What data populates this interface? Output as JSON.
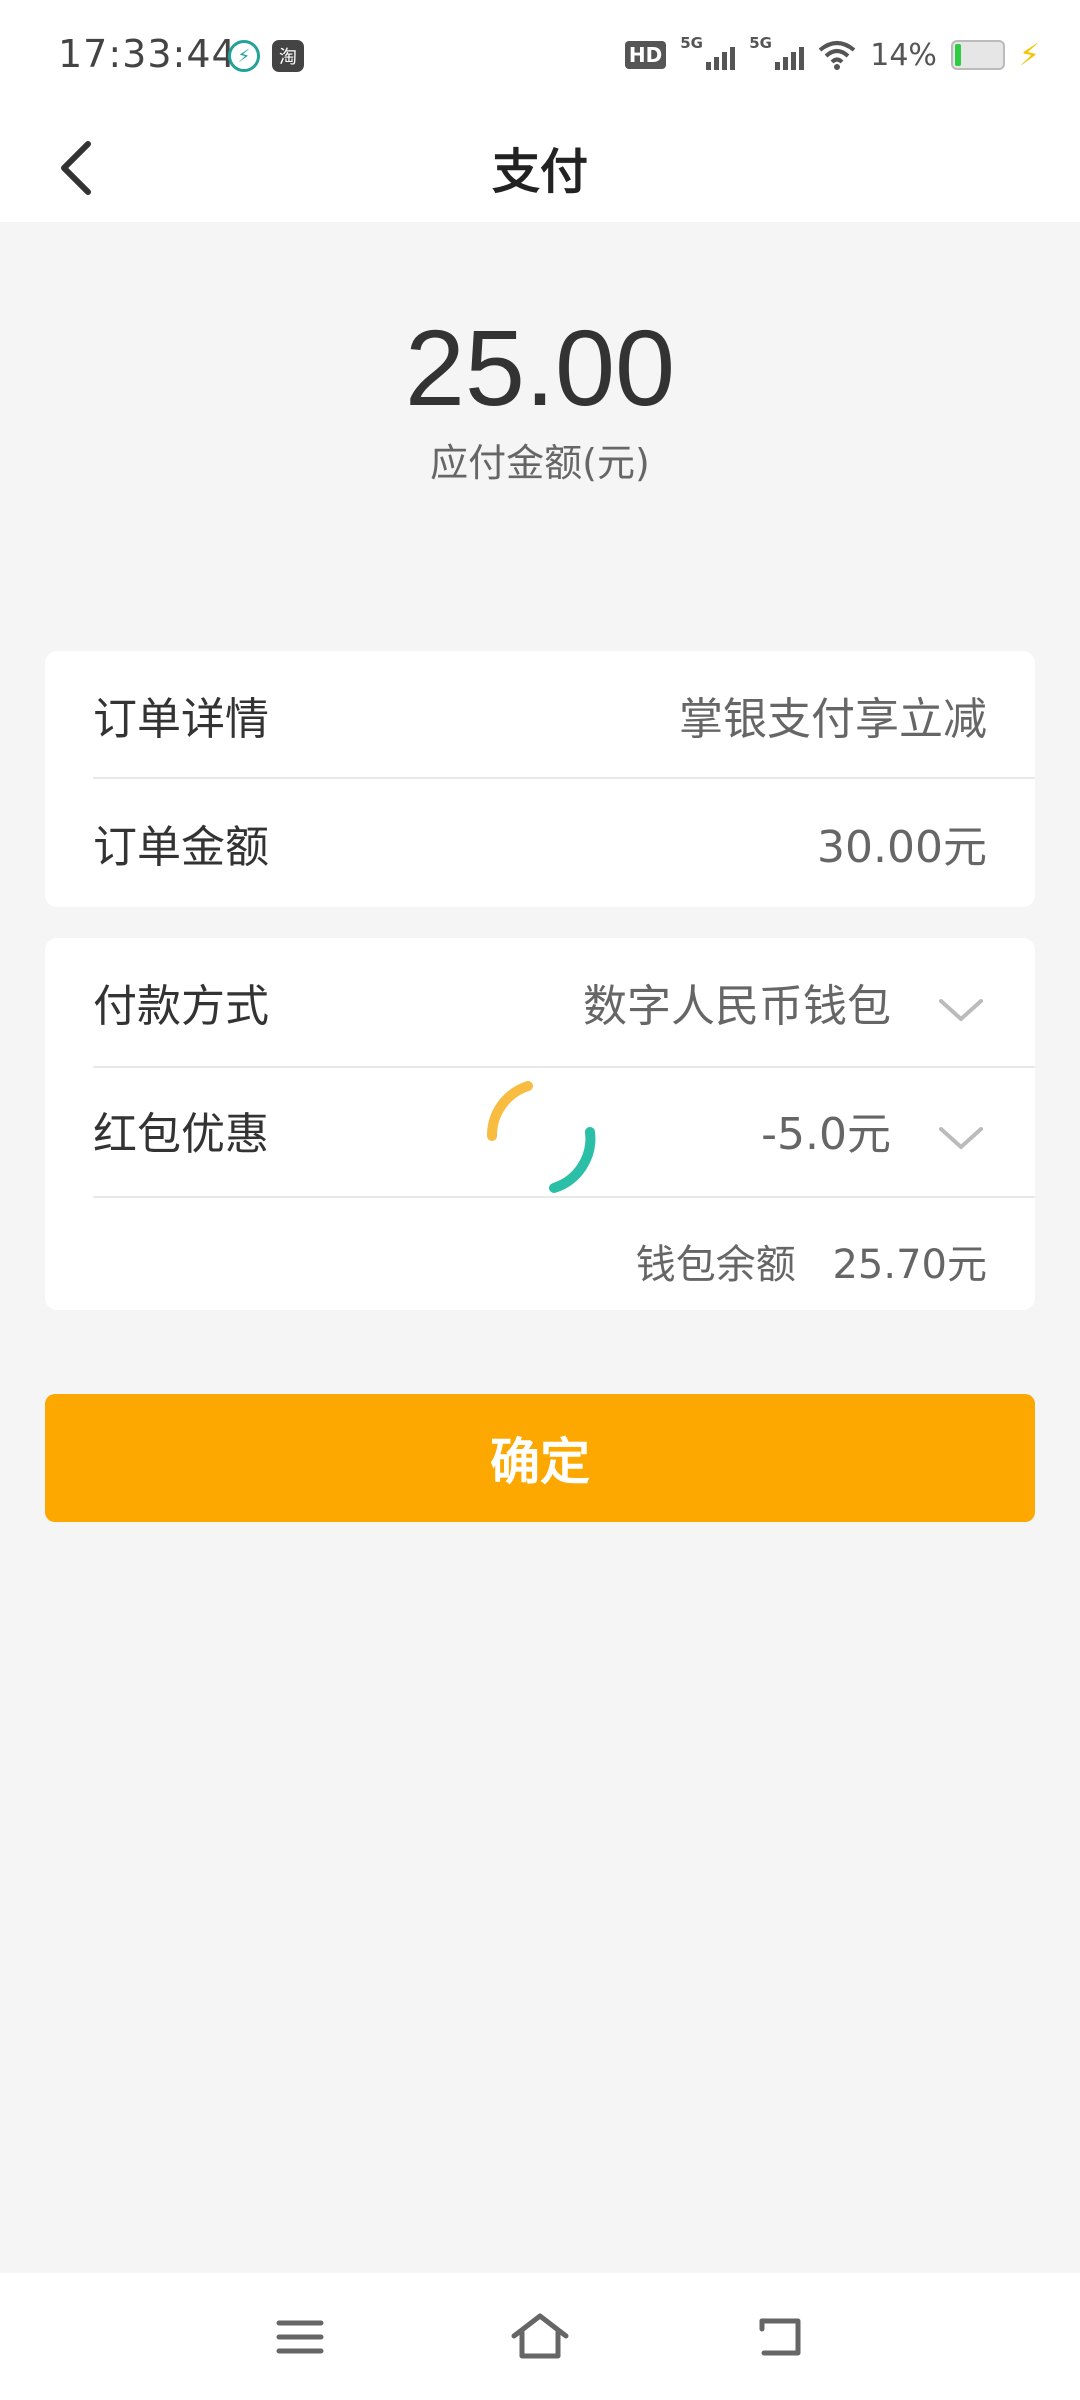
{
  "status_bar": {
    "time": "17:33:44",
    "app_icon_1": "shield-charge-icon",
    "app_icon_2_label": "淘",
    "hd_label": "HD",
    "signal_1_label": "5G",
    "signal_2_label": "5G",
    "battery_text": "14%"
  },
  "header": {
    "title": "支付",
    "back_icon": "chevron-left-icon"
  },
  "payment": {
    "amount": "25.00",
    "amount_label": "应付金额(元)"
  },
  "order_card": {
    "detail_label": "订单详情",
    "detail_value": "掌银支付享立减",
    "amount_label": "订单金额",
    "amount_value": "30.00元"
  },
  "pay_card": {
    "method_label": "付款方式",
    "method_value": "数字人民币钱包",
    "coupon_label": "红包优惠",
    "coupon_value": "-5.0元",
    "balance_label": "钱包余额",
    "balance_value": "25.70元"
  },
  "confirm": {
    "label": "确定"
  },
  "colors": {
    "accent": "#fda800",
    "discount": "#d9383e",
    "background": "#f5f5f5"
  }
}
